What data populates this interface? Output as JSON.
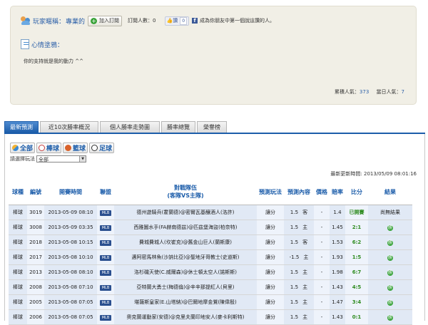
{
  "profile": {
    "nickname_label": "玩家暱稱：",
    "nickname": "專業的",
    "follow_label": "加入訂閱",
    "subscribers_label": "訂閱人數：",
    "subscribers_count": "0",
    "like_label": "讚",
    "like_count": "0",
    "fb_text": "成為你朋友中第一個說這讚的人。",
    "mood_label": "心情塗鴉：",
    "mood_text": "你的支持就是我的動力 ^^",
    "total_pop_label": "累積人氣：",
    "total_pop": "373",
    "today_pop_label": "當日人氣：",
    "today_pop": "7"
  },
  "tabs": [
    {
      "label": "最新預測",
      "active": true
    },
    {
      "label": "近10次勝率概況",
      "active": false
    },
    {
      "label": "個人勝率走勢圖",
      "active": false
    },
    {
      "label": "勝率總覽",
      "active": false
    },
    {
      "label": "榮譽榜",
      "active": false
    }
  ],
  "sports": [
    {
      "label": "全部",
      "icon": "all-sports-icon"
    },
    {
      "label": "棒球",
      "icon": "baseball-icon"
    },
    {
      "label": "籃球",
      "icon": "basketball-icon"
    },
    {
      "label": "足球",
      "icon": "soccer-icon"
    }
  ],
  "filter": {
    "label": "請選擇玩法",
    "selected": "全部"
  },
  "updated": "最新更新時間: 2013/05/09 08:01:16",
  "table": {
    "headers": {
      "sport": "球種",
      "no": "編號",
      "time": "開賽時間",
      "league": "聯盟",
      "team_line1": "對戰隊伍",
      "team_line2": "(客隊VS主隊)",
      "play": "預測玩法",
      "content": "預測內容",
      "price": "價格",
      "rate": "賠率",
      "score": "比分",
      "result": "結果"
    },
    "rows": [
      {
        "sport": "棒球",
        "no": "3019",
        "time": "2013-05-09 08:10",
        "league": "MLB",
        "teams": "德州遊騎兵(霍蘭德)@密爾瓦基釀酒人(洛許)",
        "play": "讓分",
        "line": "1.5",
        "pick": "客",
        "price": "-",
        "rate": "1.4",
        "score": "已開賽",
        "result": "尚無結果"
      },
      {
        "sport": "棒球",
        "no": "3008",
        "time": "2013-05-09 03:35",
        "league": "MLB",
        "teams": "西雅圖水手(FA赫南德茲)@匹茲堡海盜(柏奈特)",
        "play": "讓分",
        "line": "1.5",
        "pick": "主",
        "price": "-",
        "rate": "1.45",
        "score": "2:1",
        "result": "勝"
      },
      {
        "sport": "棒球",
        "no": "2018",
        "time": "2013-05-08 10:15",
        "league": "MLB",
        "teams": "費城費城人(坎崔克)@舊金山巨人(蘭斯康)",
        "play": "讓分",
        "line": "1.5",
        "pick": "客",
        "price": "-",
        "rate": "1.53",
        "score": "6:2",
        "result": "勝"
      },
      {
        "sport": "棒球",
        "no": "2017",
        "time": "2013-05-08 10:10",
        "league": "MLB",
        "teams": "邁阿密馬林魚(沙訥比亞)@聖地牙哥教士(史道斯)",
        "play": "讓分",
        "line": "-1.5",
        "pick": "主",
        "price": "-",
        "rate": "1.93",
        "score": "1:5",
        "result": "勝"
      },
      {
        "sport": "棒球",
        "no": "2013",
        "time": "2013-05-08 08:10",
        "league": "MLB",
        "teams": "洛杉磯天使(C.威爾森)@休士頓太空人(諾斯斯)",
        "play": "讓分",
        "line": "1.5",
        "pick": "主",
        "price": "-",
        "rate": "1.98",
        "score": "6:7",
        "result": "勝"
      },
      {
        "sport": "棒球",
        "no": "2008",
        "time": "2013-05-08 07:10",
        "league": "MLB",
        "teams": "亞特蘭大勇士(梅德倫)@辛辛那提紅人(貝里)",
        "play": "讓分",
        "line": "1.5",
        "pick": "主",
        "price": "-",
        "rate": "1.43",
        "score": "4:5",
        "result": "勝"
      },
      {
        "sport": "棒球",
        "no": "2005",
        "time": "2013-05-08 07:05",
        "league": "MLB",
        "teams": "堪薩斯皇家(E.山塔納)@巴爾地摩金鶯(陳偉殷)",
        "play": "讓分",
        "line": "1.5",
        "pick": "主",
        "price": "-",
        "rate": "1.47",
        "score": "3:4",
        "result": "勝"
      },
      {
        "sport": "棒球",
        "no": "2006",
        "time": "2013-05-08 07:05",
        "league": "MLB",
        "teams": "奧克蘭運動家(安德)@克里夫蘭印地安人(麥卡利斯特)",
        "play": "讓分",
        "line": "1.5",
        "pick": "主",
        "price": "-",
        "rate": "1.43",
        "score": "0:1",
        "result": "勝"
      }
    ]
  }
}
